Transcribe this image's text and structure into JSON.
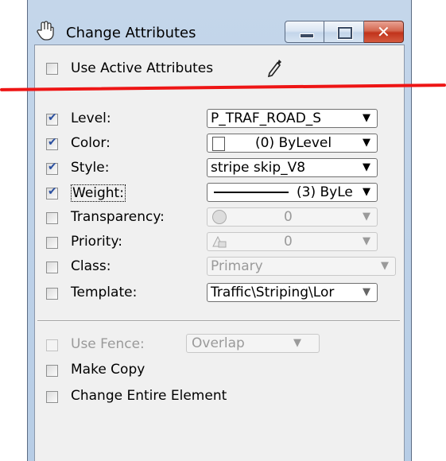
{
  "window": {
    "title": "Change Attributes",
    "minimize_label": "",
    "maximize_label": "",
    "close_label": "✕"
  },
  "use_active": {
    "label": "Use Active Attributes",
    "checked": false
  },
  "attributes": [
    {
      "key": "level",
      "label": "Level:",
      "checked": true,
      "value": "P_TRAF_ROAD_S",
      "enabled": true
    },
    {
      "key": "color",
      "label": "Color:",
      "checked": true,
      "value": "(0) ByLevel",
      "enabled": true
    },
    {
      "key": "style",
      "label": "Style:",
      "checked": true,
      "value": "stripe skip_V8",
      "enabled": true
    },
    {
      "key": "weight",
      "label": "Weight:",
      "checked": true,
      "value": "(3) ByLe",
      "enabled": true
    },
    {
      "key": "transparency",
      "label": "Transparency:",
      "checked": false,
      "value": "0",
      "enabled": false
    },
    {
      "key": "priority",
      "label": "Priority:",
      "checked": false,
      "value": "0",
      "enabled": false
    },
    {
      "key": "class",
      "label": "Class:",
      "checked": false,
      "value": "Primary",
      "enabled": false
    },
    {
      "key": "template",
      "label": "Template:",
      "checked": false,
      "value": "Traffic\\Striping\\Lor",
      "enabled": true
    }
  ],
  "fence": {
    "label": "Use Fence:",
    "value": "Overlap",
    "enabled": false
  },
  "make_copy": {
    "label": "Make Copy",
    "checked": false
  },
  "change_entire": {
    "label": "Change Entire Element",
    "checked": false
  },
  "colors": {
    "accent_check": "#2a4fa0",
    "annotation_line": "#ee1515",
    "titlebar": "#c4d6ea"
  }
}
